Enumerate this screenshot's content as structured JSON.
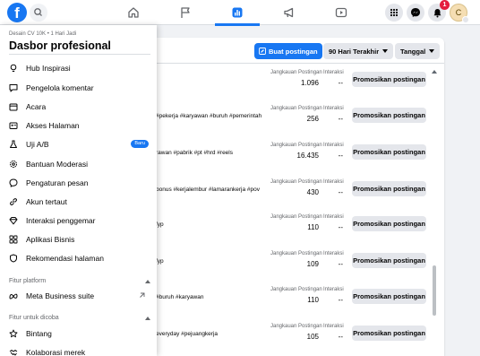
{
  "brand": {
    "accent": "#1877f2",
    "logo_letter": "f"
  },
  "header": {
    "nav": [
      {
        "icon": "home-icon",
        "active": false
      },
      {
        "icon": "flag-icon",
        "active": false
      },
      {
        "icon": "bar-chart-icon",
        "active": true
      },
      {
        "icon": "megaphone-icon",
        "active": false
      },
      {
        "icon": "video-icon",
        "active": false
      }
    ],
    "notifications_count": "1",
    "avatar_initial": "C"
  },
  "sidebar": {
    "meta": "Desain CV 10K • 1 Hari Jadi",
    "title": "Dasbor profesional",
    "items": [
      {
        "label": "Hub Inspirasi",
        "icon": "lightbulb-icon"
      },
      {
        "label": "Pengelola komentar",
        "icon": "comment-icon"
      },
      {
        "label": "Acara",
        "icon": "calendar-icon"
      },
      {
        "label": "Akses Halaman",
        "icon": "id-card-icon"
      },
      {
        "label": "Uji A/B",
        "icon": "flask-icon",
        "badge": "Baru"
      },
      {
        "label": "Bantuan Moderasi",
        "icon": "gear-icon"
      },
      {
        "label": "Pengaturan pesan",
        "icon": "message-icon"
      },
      {
        "label": "Akun tertaut",
        "icon": "link-icon"
      },
      {
        "label": "Interaksi penggemar",
        "icon": "diamond-icon"
      },
      {
        "label": "Aplikasi Bisnis",
        "icon": "apps-icon"
      },
      {
        "label": "Rekomendasi halaman",
        "icon": "shield-icon"
      }
    ],
    "section_platform": "Fitur platform",
    "platform_items": [
      {
        "label": "Meta Business suite",
        "icon": "meta-icon"
      }
    ],
    "section_try": "Fitur untuk dicoba",
    "try_items": [
      {
        "label": "Bintang",
        "icon": "star-icon"
      },
      {
        "label": "Kolaborasi merek",
        "icon": "handshake-icon"
      }
    ]
  },
  "toolbar": {
    "create_post_label": "Buat postingan",
    "range_label": "90 Hari Terakhir",
    "date_label": "Tanggal"
  },
  "posts": {
    "reach_label": "Jangkauan Postingan",
    "interaction_label": "Interaksi",
    "promote_label": "Promosikan postingan",
    "rows": [
      {
        "hashtags": "",
        "reach": "1.096",
        "interactions": "--"
      },
      {
        "hashtags": "#pekerja #karyawan #buruh #pemerintah",
        "reach": "256",
        "interactions": "--"
      },
      {
        "hashtags": "rawan #pabrik #pt #hrd #reels",
        "reach": "16.435",
        "interactions": "--"
      },
      {
        "hashtags": "bonus #kerjalembur #lamarankerja #pov",
        "reach": "430",
        "interactions": "--"
      },
      {
        "hashtags": "fyp",
        "reach": "110",
        "interactions": "--"
      },
      {
        "hashtags": "fyp",
        "reach": "109",
        "interactions": "--"
      },
      {
        "hashtags": "#buruh #karyawan",
        "reach": "110",
        "interactions": "--"
      },
      {
        "hashtags": "everyday #pejuangkerja",
        "reach": "105",
        "interactions": "--"
      }
    ]
  }
}
